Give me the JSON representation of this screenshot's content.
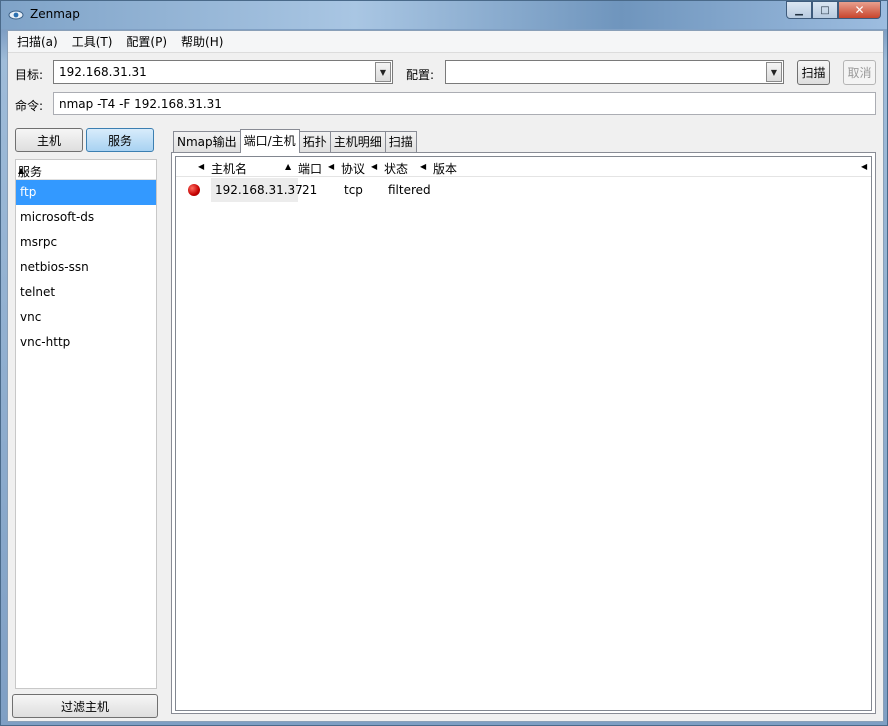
{
  "window": {
    "title": "Zenmap"
  },
  "menu": {
    "items": [
      "扫描(a)",
      "工具(T)",
      "配置(P)",
      "帮助(H)"
    ]
  },
  "target": {
    "label": "目标:",
    "value": "192.168.31.31"
  },
  "profile": {
    "label": "配置:",
    "value": ""
  },
  "buttons": {
    "scan": "扫描",
    "cancel": "取消",
    "hosts": "主机",
    "services": "服务",
    "filter_hosts": "过滤主机"
  },
  "command": {
    "label": "命令:",
    "value": "nmap -T4 -F 192.168.31.31"
  },
  "sidebar": {
    "header": "服务",
    "items": [
      "ftp",
      "microsoft-ds",
      "msrpc",
      "netbios-ssn",
      "telnet",
      "vnc",
      "vnc-http"
    ],
    "selected": "ftp"
  },
  "tabs": [
    "Nmap输出",
    "端口/主机",
    "拓扑",
    "主机明细",
    "扫描"
  ],
  "active_tab": "端口/主机",
  "table": {
    "columns": [
      "主机名",
      "端口",
      "协议",
      "状态",
      "版本"
    ],
    "rows": [
      {
        "status_color": "#cc0000",
        "host": "192.168.31.37",
        "port": "21",
        "protocol": "tcp",
        "state": "filtered",
        "version": ""
      }
    ]
  }
}
